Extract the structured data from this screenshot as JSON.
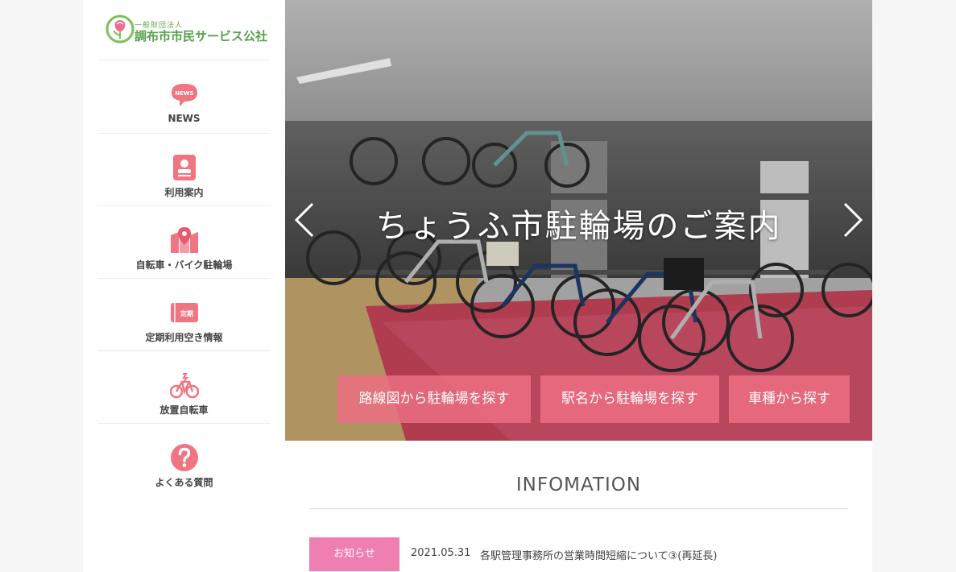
{
  "brand": {
    "small_label": "一般財団法人",
    "name": "調布市市民サービス公社"
  },
  "nav": [
    {
      "label": "NEWS",
      "icon": "news-bubble-icon",
      "badge": "NEWS"
    },
    {
      "label": "利用案内",
      "icon": "guide-book-icon"
    },
    {
      "label": "自転車・バイク駐輪場",
      "icon": "map-pin-icon"
    },
    {
      "label": "定期利用空き情報",
      "icon": "pass-ticket-icon",
      "badge": "定期"
    },
    {
      "label": "放置自転車",
      "icon": "bicycle-icon"
    },
    {
      "label": "よくある質問",
      "icon": "question-icon"
    }
  ],
  "hero": {
    "title": "ちょうふ市駐輪場のご案内",
    "buttons": [
      "路線図から駐輪場を探す",
      "駅名から駐輪場を探す",
      "車種から探す"
    ]
  },
  "info": {
    "heading": "INFOMATION",
    "items": [
      {
        "badge": "お知らせ",
        "date": "2021.05.31",
        "text": "各駅管理事務所の営業時間短縮について③(再延長)"
      }
    ]
  },
  "colors": {
    "accent_pink": "#f07583",
    "brand_green": "#57a04c",
    "badge_pink": "#f07fb1"
  }
}
